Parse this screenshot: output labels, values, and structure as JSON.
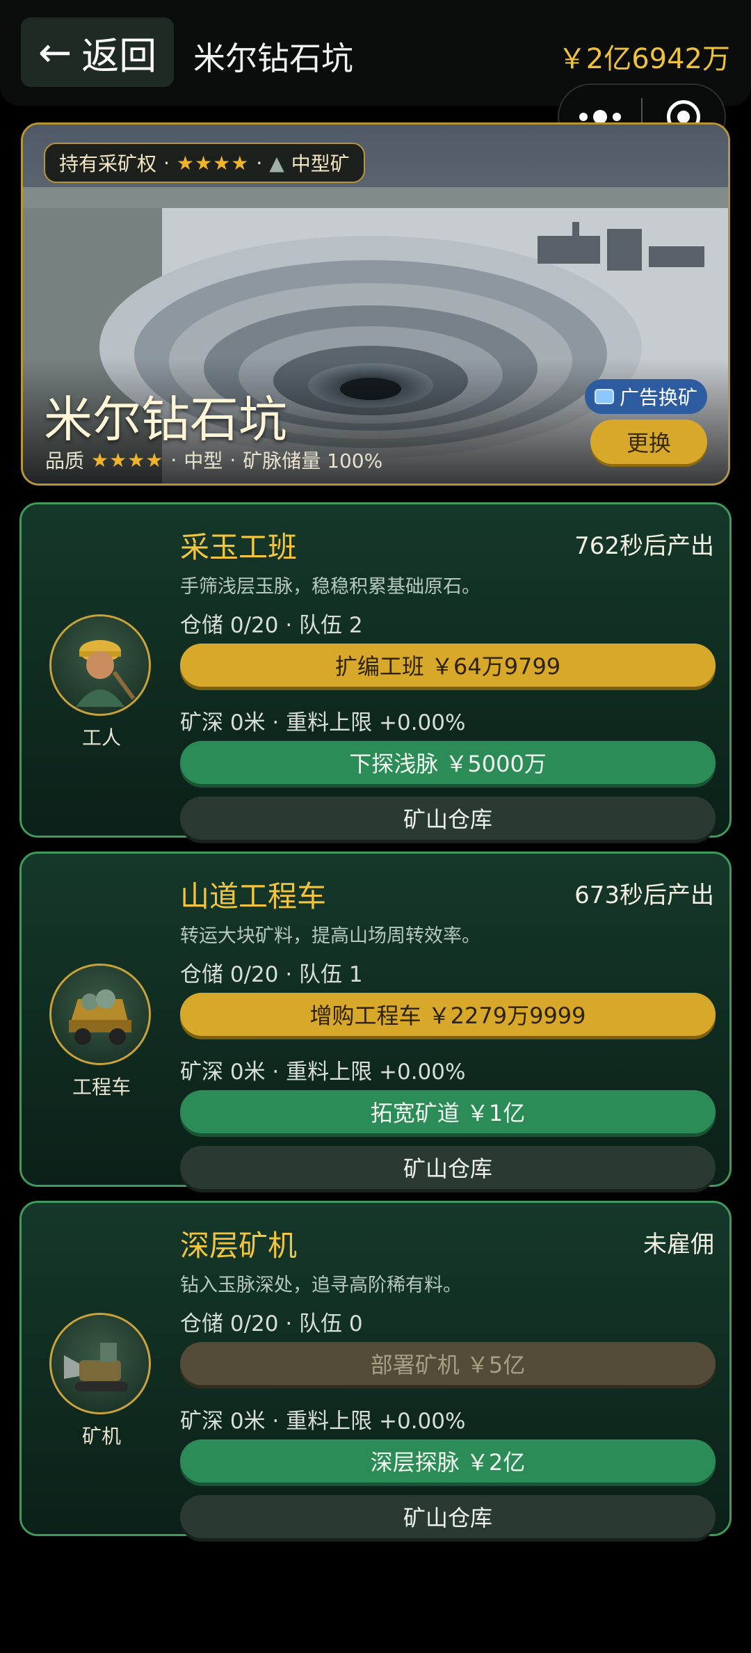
{
  "header": {
    "back_label": "返回",
    "title": "米尔钻石坑",
    "money": "￥2亿6942万"
  },
  "banner": {
    "badge_rights": "持有采矿权",
    "badge_stars": "★★★★",
    "badge_size": "中型矿",
    "mine_name": "米尔钻石坑",
    "quality_label": "品质",
    "quality_stars": "★★★★",
    "size": "中型",
    "reserve": "矿脉储量 100%",
    "ad_button": "广告换矿",
    "swap_button": "更换"
  },
  "cards": [
    {
      "avatar_label": "工人",
      "title": "采玉工班",
      "status": "762秒后产出",
      "desc": "手筛浅层玉脉，稳稳积累基础原石。",
      "storage": "仓储 0/20 · 队伍 2",
      "action": "扩编工班 ￥64万9799",
      "depth": "矿深 0米 · 重料上限 +0.00%",
      "explore": "下探浅脉 ￥5000万",
      "warehouse": "矿山仓库"
    },
    {
      "avatar_label": "工程车",
      "title": "山道工程车",
      "status": "673秒后产出",
      "desc": "转运大块矿料，提高山场周转效率。",
      "storage": "仓储 0/20 · 队伍 1",
      "action": "增购工程车 ￥2279万9999",
      "depth": "矿深 0米 · 重料上限 +0.00%",
      "explore": "拓宽矿道 ￥1亿",
      "warehouse": "矿山仓库"
    },
    {
      "avatar_label": "矿机",
      "title": "深层矿机",
      "status": "未雇佣",
      "desc": "钻入玉脉深处，追寻高阶稀有料。",
      "storage": "仓储 0/20 · 队伍 0",
      "action": "部署矿机 ￥5亿",
      "depth": "矿深 0米 · 重料上限 +0.00%",
      "explore": "深层探脉 ￥2亿",
      "warehouse": "矿山仓库"
    }
  ],
  "colors": {
    "gold": "#d7a829",
    "green": "#2c8c57",
    "card_border": "#3f9a5c",
    "money": "#f0c23c"
  }
}
